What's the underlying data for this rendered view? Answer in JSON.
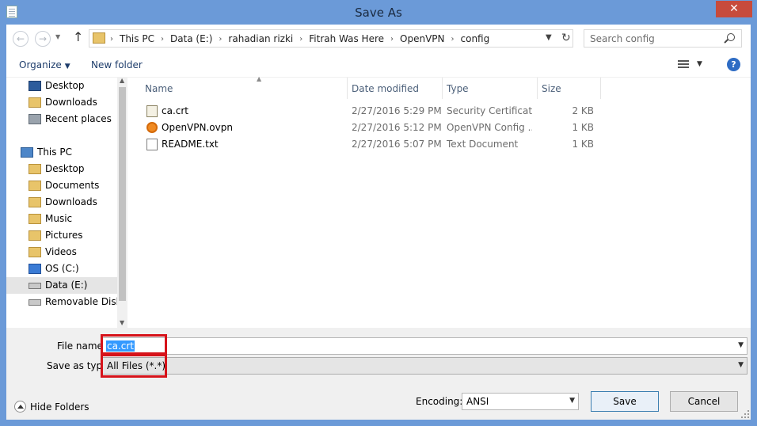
{
  "window": {
    "title": "Save As",
    "close_glyph": "✕"
  },
  "navbar": {
    "breadcrumbs": [
      "This PC",
      "Data (E:)",
      "rahadian rizki",
      "Fitrah Was Here",
      "OpenVPN",
      "config"
    ],
    "search_placeholder": "Search config"
  },
  "toolbar": {
    "organize_label": "Organize",
    "new_folder_label": "New folder",
    "help_glyph": "?"
  },
  "nav_pane": {
    "items": [
      {
        "label": "Desktop",
        "icon": "desktop-icon",
        "indent": 1
      },
      {
        "label": "Downloads",
        "icon": "downloads-folder-icon",
        "indent": 1
      },
      {
        "label": "Recent places",
        "icon": "recent-places-icon",
        "indent": 1
      },
      {
        "label": "This PC",
        "icon": "computer-icon",
        "indent": 0
      },
      {
        "label": "Desktop",
        "icon": "folder-icon",
        "indent": 1
      },
      {
        "label": "Documents",
        "icon": "folder-icon",
        "indent": 1
      },
      {
        "label": "Downloads",
        "icon": "folder-icon",
        "indent": 1
      },
      {
        "label": "Music",
        "icon": "folder-icon",
        "indent": 1
      },
      {
        "label": "Pictures",
        "icon": "folder-icon",
        "indent": 1
      },
      {
        "label": "Videos",
        "icon": "folder-icon",
        "indent": 1
      },
      {
        "label": "OS (C:)",
        "icon": "os-drive-icon",
        "indent": 1
      },
      {
        "label": "Data (E:)",
        "icon": "drive-icon",
        "indent": 1,
        "selected": true
      },
      {
        "label": "Removable Disk (",
        "icon": "removable-disk-icon",
        "indent": 1
      }
    ]
  },
  "file_list": {
    "columns": [
      "Name",
      "Date modified",
      "Type",
      "Size"
    ],
    "files": [
      {
        "name": "ca.crt",
        "date": "2/27/2016 5:29 PM",
        "type": "Security Certificate",
        "size": "2 KB",
        "icon": "certificate-icon"
      },
      {
        "name": "OpenVPN.ovpn",
        "date": "2/27/2016 5:12 PM",
        "type": "OpenVPN Config ...",
        "size": "1 KB",
        "icon": "openvpn-icon"
      },
      {
        "name": "README.txt",
        "date": "2/27/2016 5:07 PM",
        "type": "Text Document",
        "size": "1 KB",
        "icon": "text-document-icon"
      }
    ]
  },
  "form": {
    "file_name_label": "File name:",
    "file_name_value": "ca.crt",
    "save_type_label": "Save as type:",
    "save_type_value": "All Files  (*.*)",
    "encoding_label": "Encoding:",
    "encoding_value": "ANSI",
    "hide_folders_label": "Hide Folders",
    "save_label": "Save",
    "cancel_label": "Cancel"
  },
  "colors": {
    "frame": "#6b9ad8",
    "close_button": "#c74b3c",
    "highlight_box": "#d6131a",
    "selection": "#3399ff"
  }
}
